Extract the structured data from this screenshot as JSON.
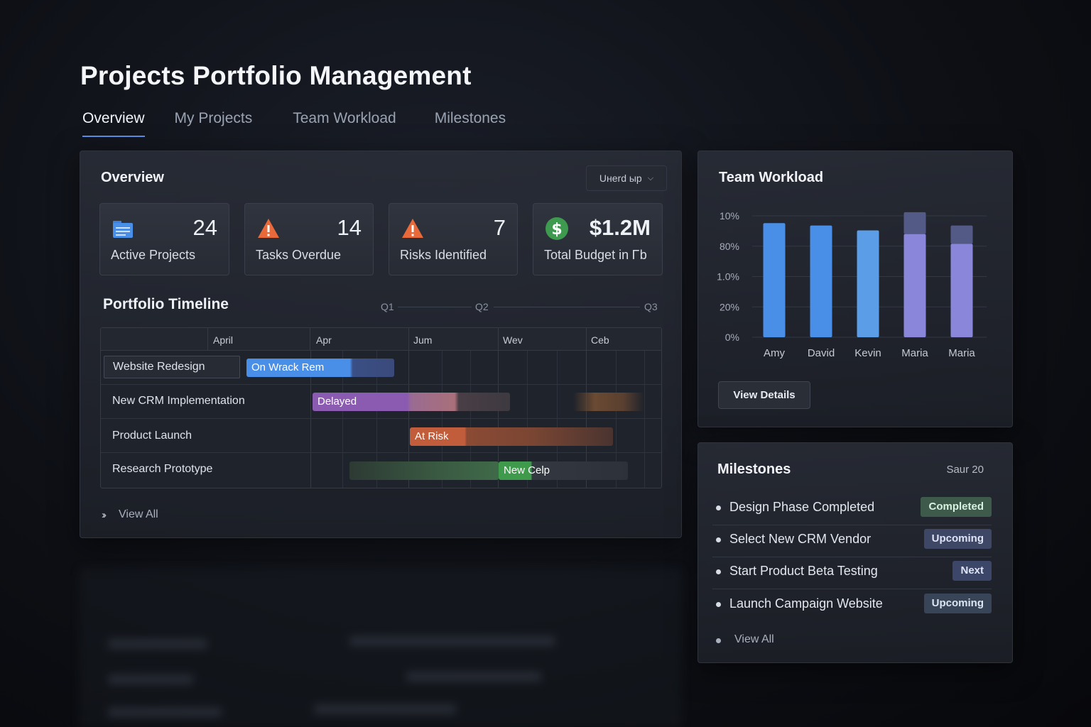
{
  "page": {
    "title": "Projects Portfolio Management"
  },
  "tabs": [
    {
      "label": "Overview",
      "active": true
    },
    {
      "label": "My Projects",
      "active": false
    },
    {
      "label": "Team Workload",
      "active": false
    },
    {
      "label": "Milestones",
      "active": false
    }
  ],
  "overview": {
    "title": "Overview",
    "dropdown_label": "Uнerd ыp",
    "stats": [
      {
        "value": "24",
        "label": "Active Projects",
        "icon": "folder-icon",
        "color": "#4a8fe7"
      },
      {
        "value": "14",
        "label": "Tasks Overdue",
        "icon": "warning-icon",
        "color": "#e8693a"
      },
      {
        "value": "7",
        "label": "Risks Identified",
        "icon": "warning-icon",
        "color": "#e8693a"
      },
      {
        "value": "$1.2M",
        "label": "Total Budget in Ꮁb",
        "icon": "dollar-icon",
        "color": "#3d9a4e"
      }
    ],
    "timeline": {
      "title": "Portfolio Timeline",
      "quarters": [
        "Q1",
        "Q2",
        "Q3"
      ],
      "months": [
        "April",
        "Apr",
        "Jum",
        "Wev",
        "Ceb"
      ],
      "rows": [
        {
          "label": "Website Redesign",
          "bar_label": "On Wrack Rem"
        },
        {
          "label": "New CRM Implementation",
          "bar_label": "Delayed"
        },
        {
          "label": "Product Launch",
          "bar_label": "At Risk"
        },
        {
          "label": "Research Prototype",
          "bar_label": "New Celp"
        }
      ]
    },
    "view_all": "View All"
  },
  "workload": {
    "title": "Team Workload",
    "button": "View Details",
    "chart_data": {
      "type": "bar",
      "categories": [
        "Amy",
        "David",
        "Kevin",
        "Maria",
        "Maria"
      ],
      "y_tick_labels": [
        "10%",
        "80%",
        "1.0%",
        "20%",
        "0%"
      ],
      "series": [
        {
          "values": [
            0.94,
            0.92,
            0.88,
            0.85,
            0.77
          ]
        },
        {
          "values": [
            0,
            0,
            0,
            0.18,
            0.15
          ]
        }
      ],
      "colors": [
        "#4a8fe7",
        "#4a8fe7",
        "#5b9de6",
        "#8a86d9",
        "#8a86d9"
      ],
      "overflow_color": "#545a86",
      "ylim": [
        0,
        1
      ],
      "grid": true
    }
  },
  "milestones": {
    "title": "Milestones",
    "date": "Saur 20",
    "items": [
      {
        "label": "Design Phase Completed",
        "status": "Completed",
        "bg": "#3d5a4a",
        "fg": "#d8f0df"
      },
      {
        "label": "Select New CRM Vendor",
        "status": "Upcoming",
        "bg": "#3e4766",
        "fg": "#dfe5f6"
      },
      {
        "label": "Start Product Beta Testing",
        "status": "Next",
        "bg": "#3b4668",
        "fg": "#dfe5f6"
      },
      {
        "label": "Launch Campaign Website",
        "status": "Upcoming",
        "bg": "#384558",
        "fg": "#dbe6f2"
      }
    ],
    "view_all": "View All"
  }
}
